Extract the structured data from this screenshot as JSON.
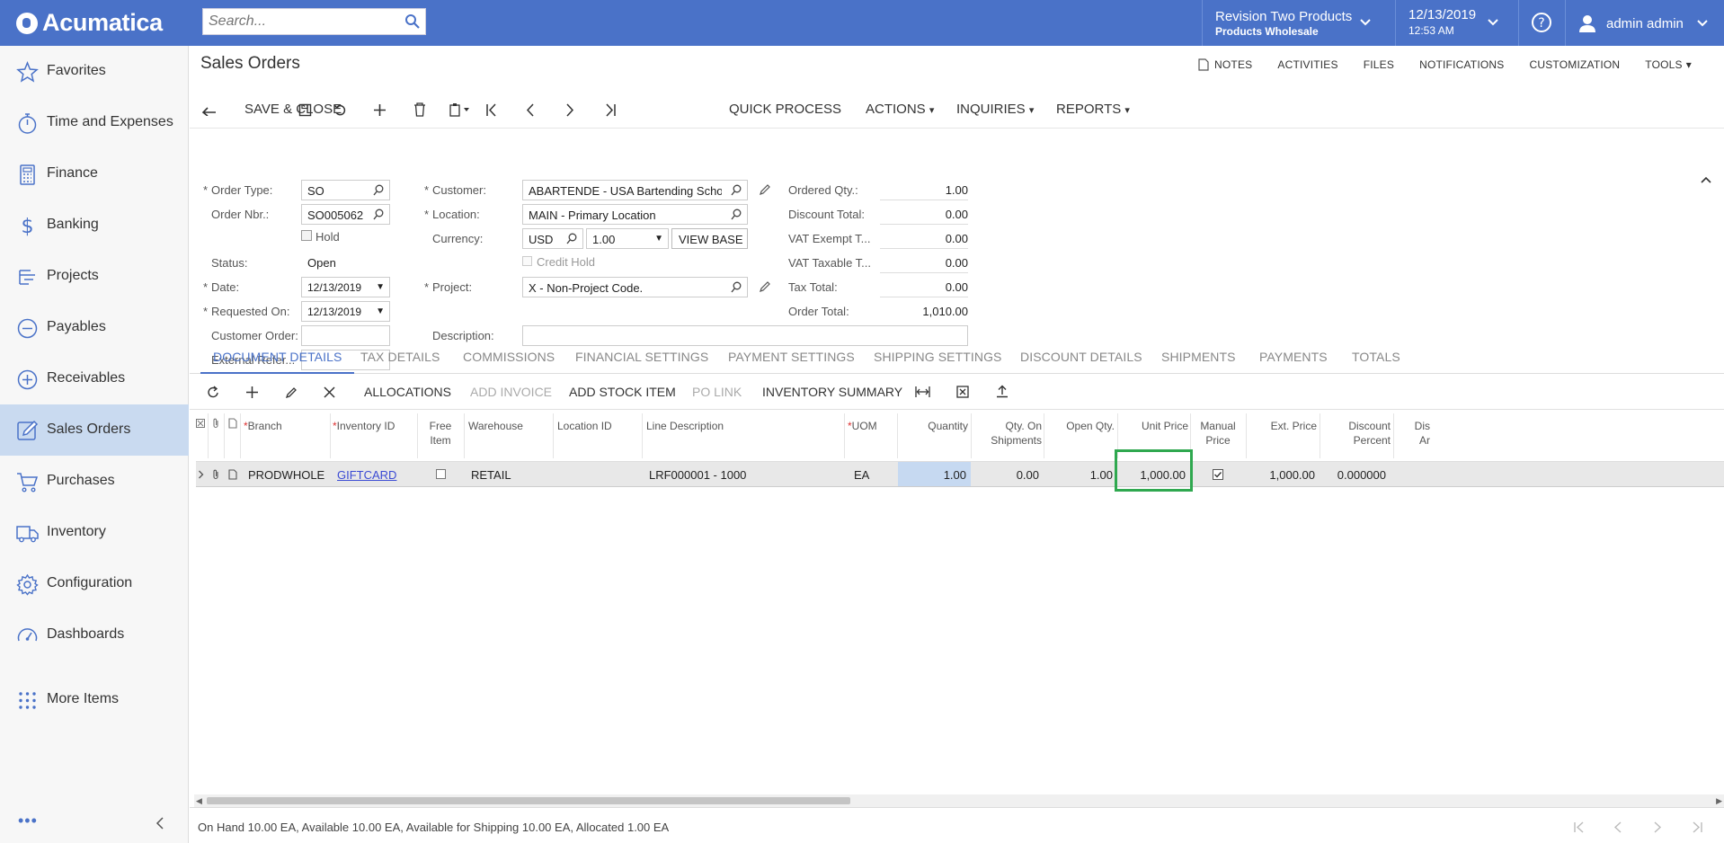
{
  "app": {
    "logo": "Acumatica",
    "search_placeholder": "Search..."
  },
  "header": {
    "branch_name": "Revision Two Products",
    "branch_sub": "Products Wholesale",
    "date": "12/13/2019",
    "time": "12:53 AM",
    "user": "admin admin"
  },
  "sidebar": {
    "items": [
      {
        "label": "Favorites",
        "icon": "star-icon"
      },
      {
        "label": "Time and Expenses",
        "icon": "stopwatch-icon"
      },
      {
        "label": "Finance",
        "icon": "calculator-icon"
      },
      {
        "label": "Banking",
        "icon": "dollar-icon"
      },
      {
        "label": "Projects",
        "icon": "projects-icon"
      },
      {
        "label": "Payables",
        "icon": "minus-circle-icon"
      },
      {
        "label": "Receivables",
        "icon": "plus-circle-icon"
      },
      {
        "label": "Sales Orders",
        "icon": "edit-icon"
      },
      {
        "label": "Purchases",
        "icon": "cart-icon"
      },
      {
        "label": "Inventory",
        "icon": "truck-icon"
      },
      {
        "label": "Configuration",
        "icon": "gear-icon"
      },
      {
        "label": "Dashboards",
        "icon": "gauge-icon"
      },
      {
        "label": "More Items",
        "icon": "grid-dots-icon"
      }
    ]
  },
  "page": {
    "title": "Sales Orders"
  },
  "toplinks": [
    "NOTES",
    "ACTIVITIES",
    "FILES",
    "NOTIFICATIONS",
    "CUSTOMIZATION",
    "TOOLS"
  ],
  "toolbar": {
    "save_close": "SAVE & CLOSE",
    "quick_process": "QUICK PROCESS",
    "actions": "ACTIONS",
    "inquiries": "INQUIRIES",
    "reports": "REPORTS"
  },
  "form": {
    "order_type_label": "Order Type:",
    "order_type": "SO",
    "order_nbr_label": "Order Nbr.:",
    "order_nbr": "SO005062",
    "hold_label": "Hold",
    "status_label": "Status:",
    "status": "Open",
    "date_label": "Date:",
    "date": "12/13/2019",
    "requested_on_label": "Requested On:",
    "requested_on": "12/13/2019",
    "customer_order_label": "Customer Order:",
    "customer_order": "",
    "external_ref_label": "External Refer...",
    "external_ref": "",
    "customer_label": "Customer:",
    "customer": "ABARTENDE - USA Bartending Schoo",
    "location_label": "Location:",
    "location": "MAIN - Primary Location",
    "currency_label": "Currency:",
    "currency": "USD",
    "currency_rate": "1.00",
    "view_base": "VIEW BASE",
    "credit_hold_label": "Credit Hold",
    "project_label": "Project:",
    "project": "X - Non-Project Code.",
    "description_label": "Description:",
    "description": "",
    "ordered_qty_label": "Ordered Qty.:",
    "ordered_qty": "1.00",
    "discount_total_label": "Discount Total:",
    "discount_total": "0.00",
    "vat_exempt_label": "VAT Exempt T...",
    "vat_exempt": "0.00",
    "vat_taxable_label": "VAT Taxable T...",
    "vat_taxable": "0.00",
    "tax_total_label": "Tax Total:",
    "tax_total": "0.00",
    "order_total_label": "Order Total:",
    "order_total": "1,010.00"
  },
  "tabs": [
    "DOCUMENT DETAILS",
    "TAX DETAILS",
    "COMMISSIONS",
    "FINANCIAL SETTINGS",
    "PAYMENT SETTINGS",
    "SHIPPING SETTINGS",
    "DISCOUNT DETAILS",
    "SHIPMENTS",
    "PAYMENTS",
    "TOTALS"
  ],
  "grid_toolbar": {
    "allocations": "ALLOCATIONS",
    "add_invoice": "ADD INVOICE",
    "add_stock_item": "ADD STOCK ITEM",
    "po_link": "PO LINK",
    "inventory_summary": "INVENTORY SUMMARY"
  },
  "grid": {
    "headers": {
      "branch": "Branch",
      "inventory_id": "Inventory ID",
      "free_item_1": "Free",
      "free_item_2": "Item",
      "warehouse": "Warehouse",
      "location_id": "Location ID",
      "line_description": "Line Description",
      "uom": "UOM",
      "quantity": "Quantity",
      "qty_on_ship_1": "Qty. On",
      "qty_on_ship_2": "Shipments",
      "open_qty": "Open Qty.",
      "unit_price": "Unit Price",
      "manual_price_1": "Manual",
      "manual_price_2": "Price",
      "ext_price": "Ext. Price",
      "discount_percent_1": "Discount",
      "discount_percent_2": "Percent",
      "disc_amount_1": "Dis",
      "disc_amount_2": "Ar"
    },
    "row": {
      "branch": "PRODWHOLE",
      "inventory_id": "GIFTCARD",
      "warehouse": "RETAIL",
      "location_id": "",
      "line_description": "LRF000001 - 1000",
      "uom": "EA",
      "quantity": "1.00",
      "qty_on_shipments": "0.00",
      "open_qty": "1.00",
      "unit_price": "1,000.00",
      "ext_price": "1,000.00",
      "discount_percent": "0.000000"
    }
  },
  "status_bar": "On Hand 10.00 EA, Available 10.00 EA, Available for Shipping 10.00 EA, Allocated 1.00 EA",
  "colors": {
    "brand": "#4a72c8",
    "active_nav": "#c9daf0",
    "highlight": "#2fa84f"
  }
}
